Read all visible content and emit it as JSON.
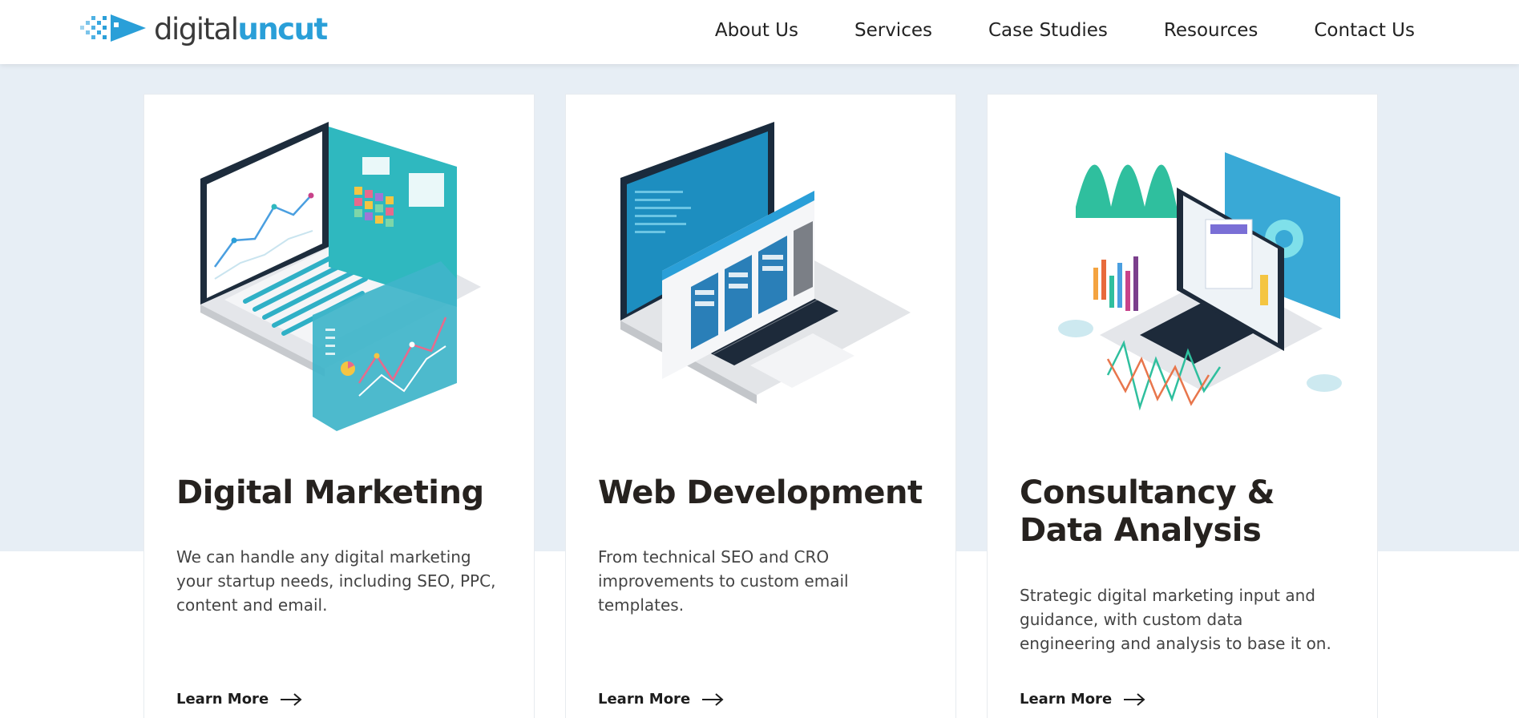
{
  "header": {
    "logo_text_part1": "digital",
    "logo_text_part2": "uncut",
    "nav": [
      "About Us",
      "Services",
      "Case Studies",
      "Resources",
      "Contact Us"
    ]
  },
  "colors": {
    "brand_blue": "#2a9fd8",
    "teal": "#2fb8bf",
    "band_bg": "#e7eef5",
    "heading": "#26221f"
  },
  "cards": [
    {
      "illustration": "laptop-analytics-illustration",
      "title": "Digital Marketing",
      "text": "We can handle any digital marketing your startup needs, including SEO, PPC, content and email.",
      "link": "Learn More",
      "arrow_icon": "arrow-right-icon"
    },
    {
      "illustration": "laptop-code-illustration",
      "title": "Web Development",
      "text": "From technical SEO and CRO improvements to custom email templates.",
      "link": "Learn More",
      "arrow_icon": "arrow-right-icon"
    },
    {
      "illustration": "laptop-data-illustration",
      "title": "Consultancy & Data Analysis",
      "text": "Strategic digital marketing input and guidance, with custom data engineering and analysis to base it on.",
      "link": "Learn More",
      "arrow_icon": "arrow-right-icon"
    }
  ]
}
